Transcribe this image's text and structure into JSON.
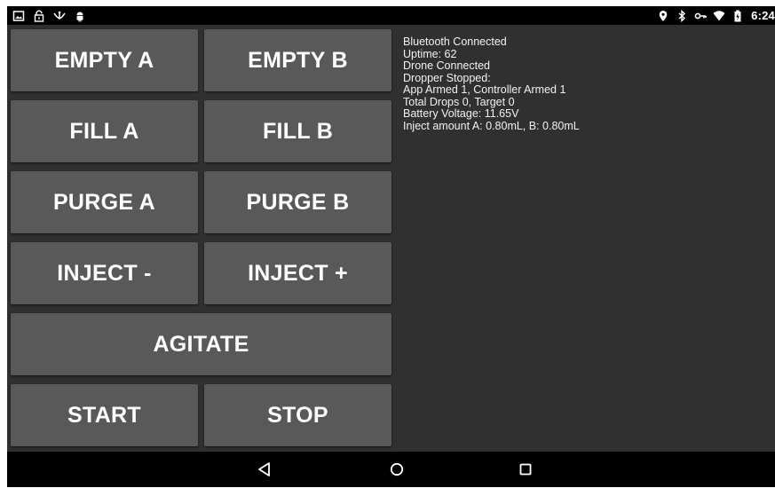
{
  "status_bar": {
    "time": "6:24",
    "left_icons": [
      "image-icon",
      "lock-icon",
      "usb-icon",
      "android-icon"
    ],
    "right_icons": [
      "location-icon",
      "bluetooth-icon",
      "vpn-key-icon",
      "wifi-icon",
      "battery-icon"
    ]
  },
  "buttons": {
    "empty_a": "EMPTY A",
    "empty_b": "EMPTY B",
    "fill_a": "FILL A",
    "fill_b": "FILL B",
    "purge_a": "PURGE A",
    "purge_b": "PURGE B",
    "inject_minus": "INJECT -",
    "inject_plus": "INJECT +",
    "agitate": "AGITATE",
    "start": "START",
    "stop": "STOP"
  },
  "status_lines": [
    "Bluetooth Connected",
    "Uptime: 62",
    "Drone Connected",
    "Dropper Stopped:",
    "App Armed 1, Controller Armed 1",
    "Total Drops 0, Target 0",
    "Battery Voltage: 11.65V",
    "Inject amount A: 0.80mL, B: 0.80mL"
  ],
  "navbar": {
    "icons": [
      "back-icon",
      "home-icon",
      "recents-icon"
    ]
  },
  "colors": {
    "background": "#303030",
    "button": "#595959",
    "text": "#ffffff",
    "bars": "#000000"
  }
}
